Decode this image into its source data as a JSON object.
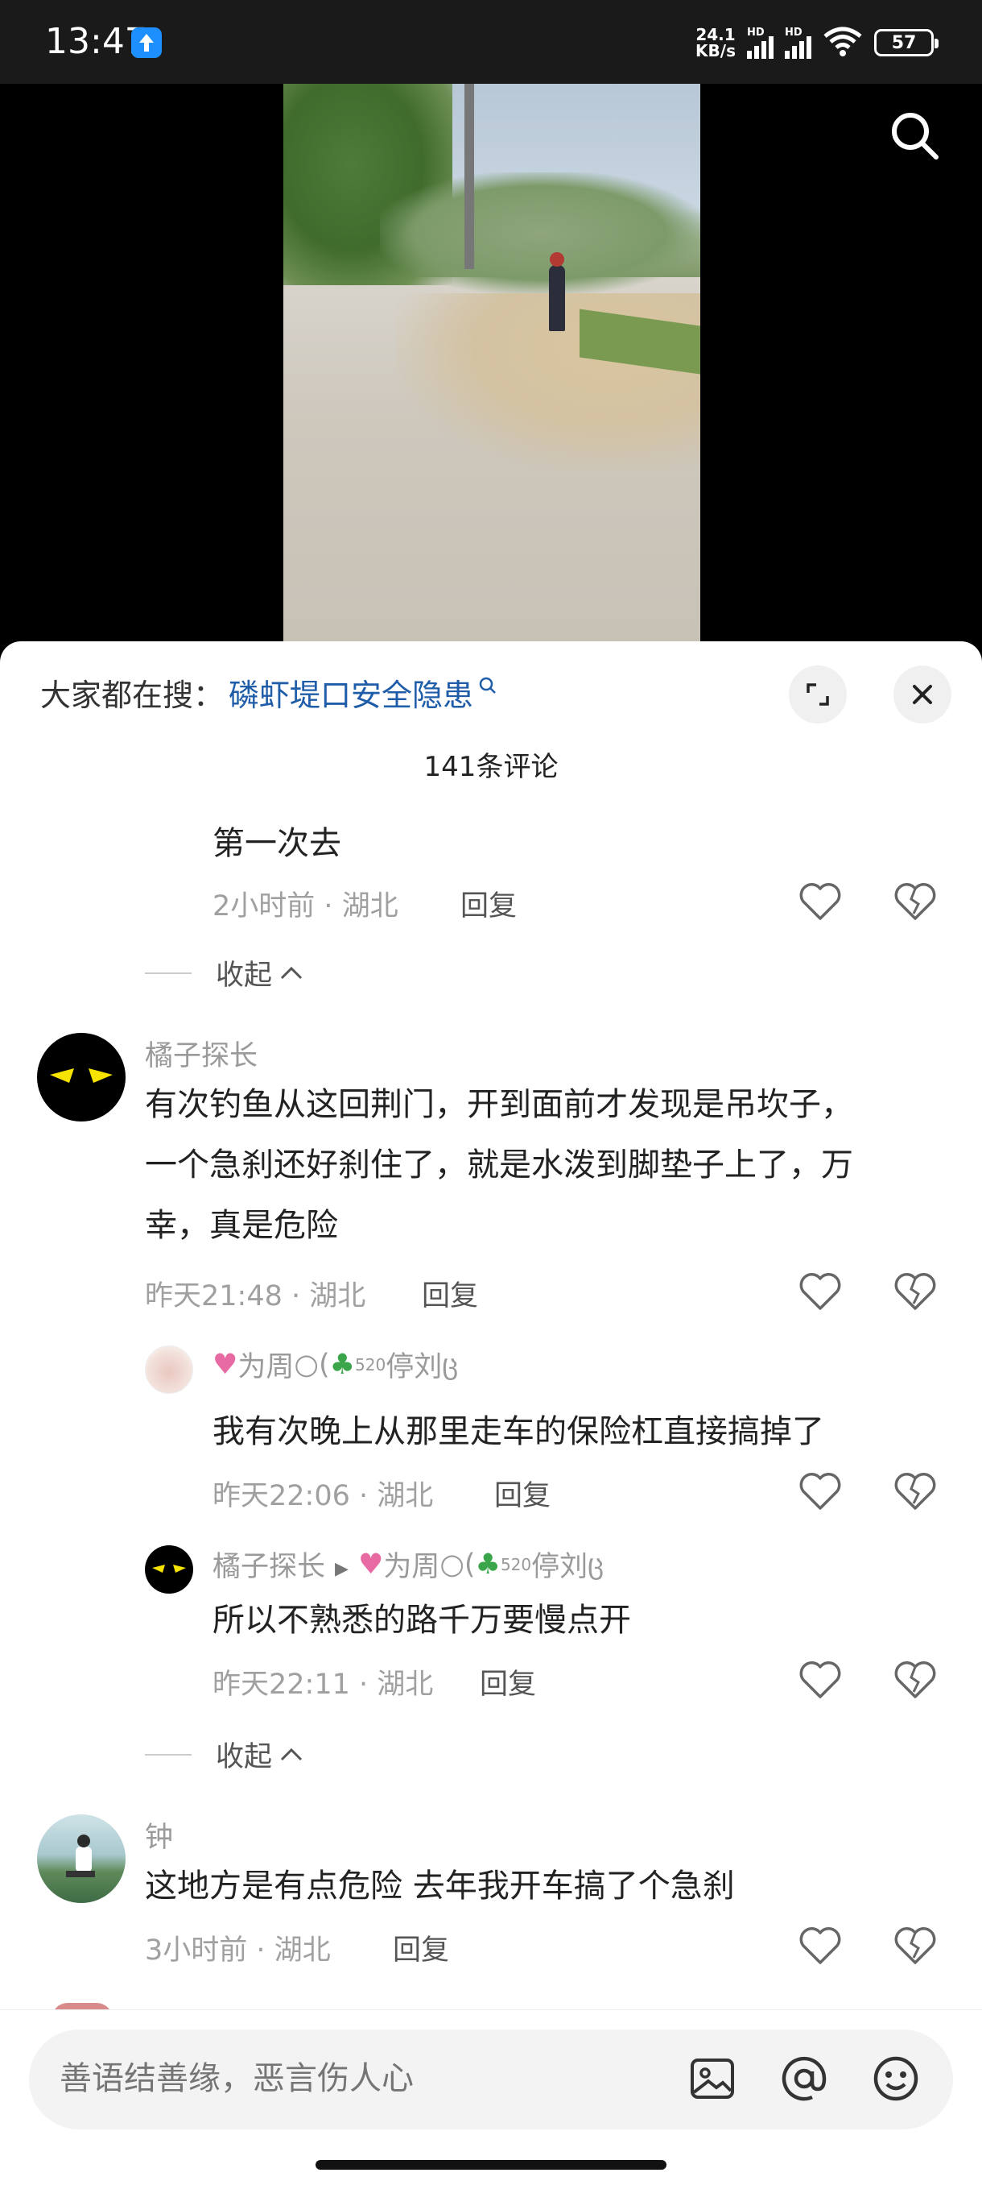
{
  "status_bar": {
    "time": "13:47",
    "net_speed_value": "24.1",
    "net_speed_unit": "KB/s",
    "signal_1_label": "HD",
    "signal_2_label": "HD",
    "battery": "57"
  },
  "hot_search": {
    "label": "大家都在搜：",
    "topic": "磷虾堤口安全隐患"
  },
  "comment_count": "141条评论",
  "comments": [
    {
      "text": "第一次去",
      "time": "2小时前",
      "location": "湖北",
      "reply": "回复"
    },
    {
      "collapse": "收起"
    },
    {
      "username": "橘子探长",
      "text_lines": [
        "有次钓鱼从这回荆门，开到面前才发现是吊坎子，",
        "一个急刹还好刹住了，就是水泼到脚垫子上了，万",
        "幸，真是危险"
      ],
      "time": "昨天21:48",
      "location": "湖北",
      "reply": "回复"
    },
    {
      "username_parts": [
        "为周",
        "停刘"
      ],
      "decor_num": "520",
      "text": "我有次晚上从那里走车的保险杠直接搞掉了",
      "time": "昨天22:06",
      "location": "湖北",
      "reply": "回复"
    },
    {
      "username": "橘子探长",
      "reply_to_parts": [
        "为周",
        "停刘"
      ],
      "decor_num": "520",
      "text": "所以不熟悉的路千万要慢点开",
      "time": "昨天22:11",
      "location": "湖北",
      "reply": "回复"
    },
    {
      "collapse": "收起"
    },
    {
      "username": "钟",
      "text": "这地方是有点危险 去年我开车搞了个急刹",
      "time": "3小时前",
      "location": "湖北",
      "reply": "回复"
    }
  ],
  "input": {
    "placeholder": "善语结善缘，恶言伤人心"
  },
  "colors": {
    "link_blue": "#1f5da9",
    "meta_gray": "#a0a0a0",
    "accent_status_blue": "#1e8fff"
  },
  "icons": [
    "arrow-up-icon",
    "search-icon",
    "expand-icon",
    "close-icon",
    "heart-icon",
    "broken-heart-icon",
    "image-icon",
    "at-icon",
    "emoji-icon"
  ]
}
